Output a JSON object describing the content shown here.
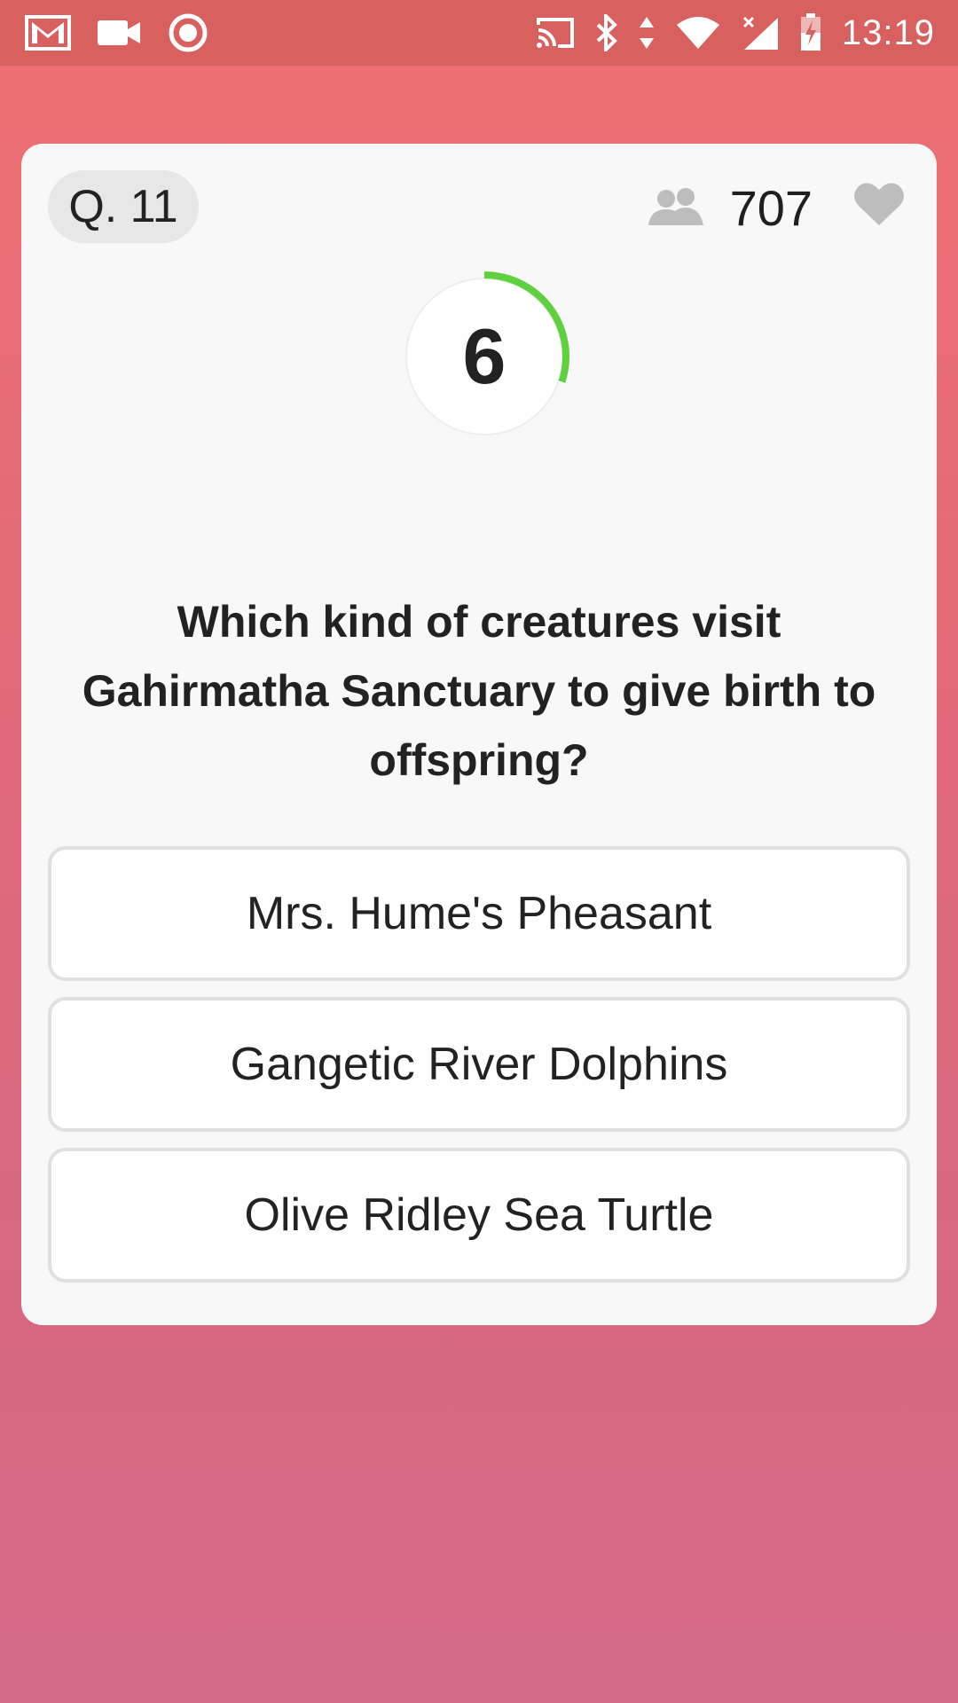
{
  "status_bar": {
    "time": "13:19",
    "left_icons": [
      "gmail-icon",
      "video-camera-icon",
      "record-icon"
    ],
    "right_icons": [
      "cast-icon",
      "bluetooth-icon",
      "data-arrows-icon",
      "wifi-icon",
      "no-signal-icon",
      "battery-charging-icon"
    ]
  },
  "card": {
    "question_number": "Q. 11",
    "player_count": "707",
    "timer": {
      "seconds": "6",
      "remaining_fraction": 0.3,
      "color": "#5fd13f"
    },
    "question": "Which kind of creatures visit Gahirmatha Sanctuary to give birth to offspring?",
    "answers": [
      {
        "label": "Mrs. Hume's Pheasant"
      },
      {
        "label": "Gangetic River Dolphins"
      },
      {
        "label": "Olive Ridley Sea Turtle"
      }
    ]
  },
  "colors": {
    "background_top": "#ee6f72",
    "background_bottom": "#d56a87",
    "status_bar": "#d8605f",
    "card": "#f7f8f7"
  }
}
